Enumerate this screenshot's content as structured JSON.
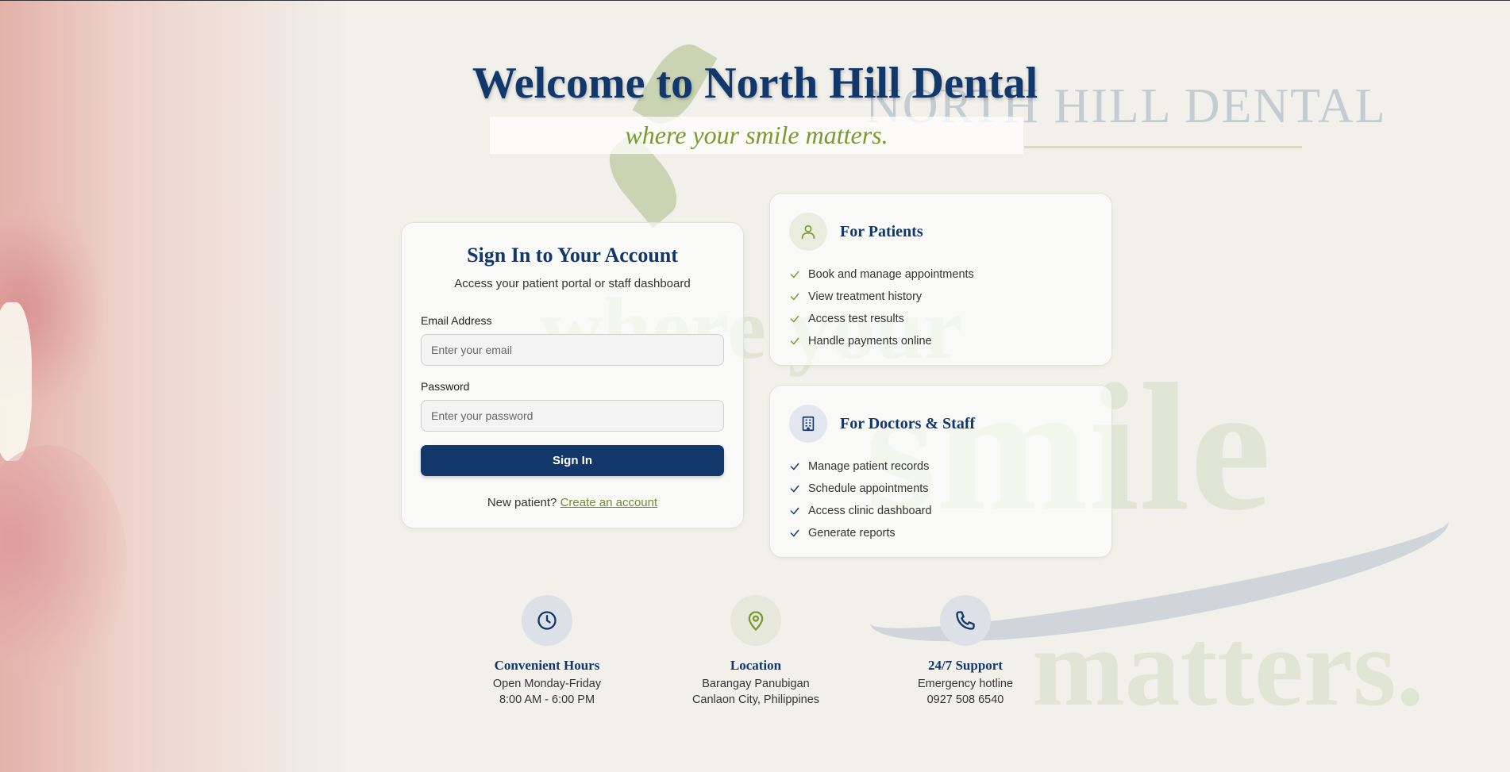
{
  "hero": {
    "title": "Welcome to North Hill Dental",
    "tagline": "where your smile matters."
  },
  "watermark": {
    "logo_text": "NORTH HILL DENTAL",
    "words": [
      "where your",
      "smile",
      "matters."
    ]
  },
  "signin": {
    "title": "Sign In to Your Account",
    "subtitle": "Access your patient portal or staff dashboard",
    "email_label": "Email Address",
    "email_placeholder": "Enter your email",
    "password_label": "Password",
    "password_placeholder": "Enter your password",
    "button_label": "Sign In",
    "new_patient_text": "New patient?",
    "create_account_link": "Create an account"
  },
  "patients": {
    "icon": "user-icon",
    "title": "For Patients",
    "items": [
      "Book and manage appointments",
      "View treatment history",
      "Access test results",
      "Handle payments online"
    ]
  },
  "staff": {
    "icon": "building-icon",
    "title": "For Doctors & Staff",
    "items": [
      "Manage patient records",
      "Schedule appointments",
      "Access clinic dashboard",
      "Generate reports"
    ]
  },
  "features": [
    {
      "icon": "clock-icon",
      "title": "Convenient Hours",
      "line1": "Open Monday-Friday",
      "line2": "8:00 AM - 6:00 PM"
    },
    {
      "icon": "map-pin-icon",
      "title": "Location",
      "line1": "Barangay Panubigan",
      "line2": "Canlaon City, Philippines"
    },
    {
      "icon": "phone-icon",
      "title": "24/7 Support",
      "line1": "Emergency hotline",
      "line2": "0927 508 6540"
    }
  ],
  "colors": {
    "navy": "#12376b",
    "green": "#7a9a2e",
    "background": "#f1f0eb"
  }
}
